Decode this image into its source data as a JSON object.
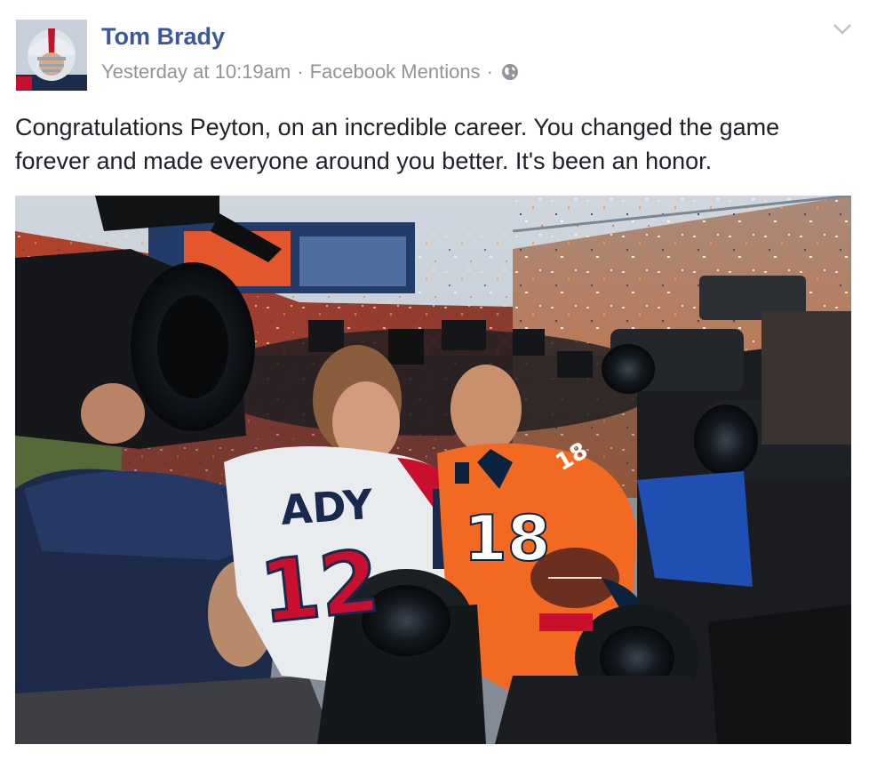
{
  "post": {
    "author": "Tom Brady",
    "timestamp": "Yesterday at 10:19am",
    "separator": "·",
    "source": "Facebook Mentions",
    "privacy_icon": "globe-icon",
    "menu_icon": "chevron-down-icon",
    "message": "Congratulations Peyton, on an incredible career. You changed the game forever and made everyone around you better. It's been an honor.",
    "photo": {
      "jersey_left_name": "ADY",
      "jersey_left_number": "12",
      "jersey_right_number": "18",
      "sleeve_number": "18"
    }
  },
  "colors": {
    "author_link": "#3b5998",
    "meta_text": "#90949c",
    "body_text": "#1d2129",
    "broncos_orange": "#f26a21",
    "patriots_navy": "#0c2340"
  }
}
